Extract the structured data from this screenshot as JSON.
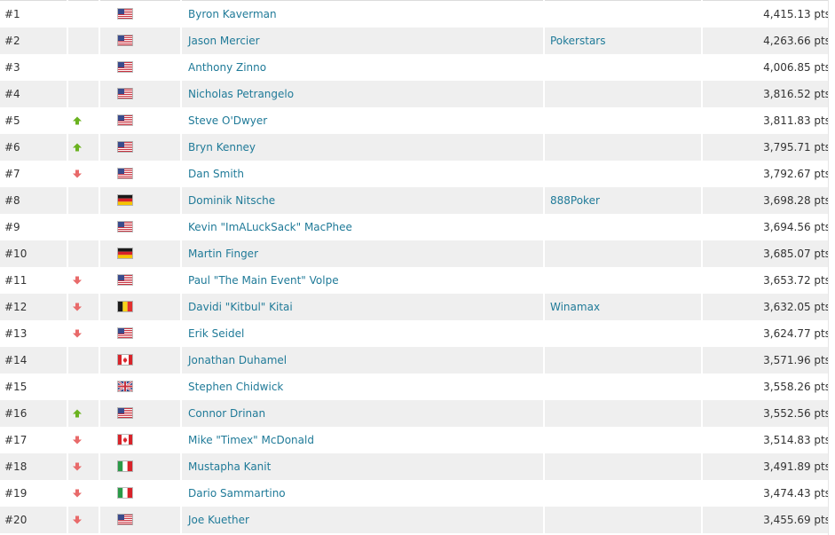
{
  "colors": {
    "link": "#1f7a98",
    "row_alt": "#efefef",
    "trend_up": "#6ab21f",
    "trend_down": "#e86a6a"
  },
  "rankings": [
    {
      "rank": "#1",
      "trend": "none",
      "flag": "us",
      "name": "Byron Kaverman",
      "site": "",
      "points": "4,415.13 pts"
    },
    {
      "rank": "#2",
      "trend": "none",
      "flag": "us",
      "name": "Jason Mercier",
      "site": "Pokerstars",
      "points": "4,263.66 pts"
    },
    {
      "rank": "#3",
      "trend": "none",
      "flag": "us",
      "name": "Anthony Zinno",
      "site": "",
      "points": "4,006.85 pts"
    },
    {
      "rank": "#4",
      "trend": "none",
      "flag": "us",
      "name": "Nicholas Petrangelo",
      "site": "",
      "points": "3,816.52 pts"
    },
    {
      "rank": "#5",
      "trend": "up",
      "flag": "us",
      "name": "Steve O'Dwyer",
      "site": "",
      "points": "3,811.83 pts"
    },
    {
      "rank": "#6",
      "trend": "up",
      "flag": "us",
      "name": "Bryn Kenney",
      "site": "",
      "points": "3,795.71 pts"
    },
    {
      "rank": "#7",
      "trend": "down",
      "flag": "us",
      "name": "Dan Smith",
      "site": "",
      "points": "3,792.67 pts"
    },
    {
      "rank": "#8",
      "trend": "none",
      "flag": "de",
      "name": "Dominik Nitsche",
      "site": "888Poker",
      "points": "3,698.28 pts"
    },
    {
      "rank": "#9",
      "trend": "none",
      "flag": "us",
      "name": "Kevin \"ImALuckSack\" MacPhee",
      "site": "",
      "points": "3,694.56 pts"
    },
    {
      "rank": "#10",
      "trend": "none",
      "flag": "de",
      "name": "Martin Finger",
      "site": "",
      "points": "3,685.07 pts"
    },
    {
      "rank": "#11",
      "trend": "down",
      "flag": "us",
      "name": "Paul \"The Main Event\" Volpe",
      "site": "",
      "points": "3,653.72 pts"
    },
    {
      "rank": "#12",
      "trend": "down",
      "flag": "be",
      "name": "Davidi \"Kitbul\" Kitai",
      "site": "Winamax",
      "points": "3,632.05 pts"
    },
    {
      "rank": "#13",
      "trend": "down",
      "flag": "us",
      "name": "Erik Seidel",
      "site": "",
      "points": "3,624.77 pts"
    },
    {
      "rank": "#14",
      "trend": "none",
      "flag": "ca",
      "name": "Jonathan Duhamel",
      "site": "",
      "points": "3,571.96 pts"
    },
    {
      "rank": "#15",
      "trend": "none",
      "flag": "gb",
      "name": "Stephen Chidwick",
      "site": "",
      "points": "3,558.26 pts"
    },
    {
      "rank": "#16",
      "trend": "up",
      "flag": "us",
      "name": "Connor Drinan",
      "site": "",
      "points": "3,552.56 pts"
    },
    {
      "rank": "#17",
      "trend": "down",
      "flag": "ca",
      "name": "Mike \"Timex\" McDonald",
      "site": "",
      "points": "3,514.83 pts"
    },
    {
      "rank": "#18",
      "trend": "down",
      "flag": "it",
      "name": "Mustapha Kanit",
      "site": "",
      "points": "3,491.89 pts"
    },
    {
      "rank": "#19",
      "trend": "down",
      "flag": "it",
      "name": "Dario Sammartino",
      "site": "",
      "points": "3,474.43 pts"
    },
    {
      "rank": "#20",
      "trend": "down",
      "flag": "us",
      "name": "Joe Kuether",
      "site": "",
      "points": "3,455.69 pts"
    }
  ]
}
